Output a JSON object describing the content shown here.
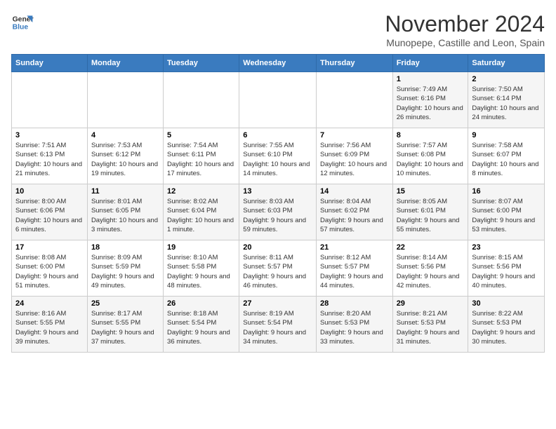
{
  "header": {
    "logo_line1": "General",
    "logo_line2": "Blue",
    "title": "November 2024",
    "subtitle": "Munopepe, Castille and Leon, Spain"
  },
  "weekdays": [
    "Sunday",
    "Monday",
    "Tuesday",
    "Wednesday",
    "Thursday",
    "Friday",
    "Saturday"
  ],
  "weeks": [
    [
      {
        "day": "",
        "info": ""
      },
      {
        "day": "",
        "info": ""
      },
      {
        "day": "",
        "info": ""
      },
      {
        "day": "",
        "info": ""
      },
      {
        "day": "",
        "info": ""
      },
      {
        "day": "1",
        "info": "Sunrise: 7:49 AM\nSunset: 6:16 PM\nDaylight: 10 hours and 26 minutes."
      },
      {
        "day": "2",
        "info": "Sunrise: 7:50 AM\nSunset: 6:14 PM\nDaylight: 10 hours and 24 minutes."
      }
    ],
    [
      {
        "day": "3",
        "info": "Sunrise: 7:51 AM\nSunset: 6:13 PM\nDaylight: 10 hours and 21 minutes."
      },
      {
        "day": "4",
        "info": "Sunrise: 7:53 AM\nSunset: 6:12 PM\nDaylight: 10 hours and 19 minutes."
      },
      {
        "day": "5",
        "info": "Sunrise: 7:54 AM\nSunset: 6:11 PM\nDaylight: 10 hours and 17 minutes."
      },
      {
        "day": "6",
        "info": "Sunrise: 7:55 AM\nSunset: 6:10 PM\nDaylight: 10 hours and 14 minutes."
      },
      {
        "day": "7",
        "info": "Sunrise: 7:56 AM\nSunset: 6:09 PM\nDaylight: 10 hours and 12 minutes."
      },
      {
        "day": "8",
        "info": "Sunrise: 7:57 AM\nSunset: 6:08 PM\nDaylight: 10 hours and 10 minutes."
      },
      {
        "day": "9",
        "info": "Sunrise: 7:58 AM\nSunset: 6:07 PM\nDaylight: 10 hours and 8 minutes."
      }
    ],
    [
      {
        "day": "10",
        "info": "Sunrise: 8:00 AM\nSunset: 6:06 PM\nDaylight: 10 hours and 6 minutes."
      },
      {
        "day": "11",
        "info": "Sunrise: 8:01 AM\nSunset: 6:05 PM\nDaylight: 10 hours and 3 minutes."
      },
      {
        "day": "12",
        "info": "Sunrise: 8:02 AM\nSunset: 6:04 PM\nDaylight: 10 hours and 1 minute."
      },
      {
        "day": "13",
        "info": "Sunrise: 8:03 AM\nSunset: 6:03 PM\nDaylight: 9 hours and 59 minutes."
      },
      {
        "day": "14",
        "info": "Sunrise: 8:04 AM\nSunset: 6:02 PM\nDaylight: 9 hours and 57 minutes."
      },
      {
        "day": "15",
        "info": "Sunrise: 8:05 AM\nSunset: 6:01 PM\nDaylight: 9 hours and 55 minutes."
      },
      {
        "day": "16",
        "info": "Sunrise: 8:07 AM\nSunset: 6:00 PM\nDaylight: 9 hours and 53 minutes."
      }
    ],
    [
      {
        "day": "17",
        "info": "Sunrise: 8:08 AM\nSunset: 6:00 PM\nDaylight: 9 hours and 51 minutes."
      },
      {
        "day": "18",
        "info": "Sunrise: 8:09 AM\nSunset: 5:59 PM\nDaylight: 9 hours and 49 minutes."
      },
      {
        "day": "19",
        "info": "Sunrise: 8:10 AM\nSunset: 5:58 PM\nDaylight: 9 hours and 48 minutes."
      },
      {
        "day": "20",
        "info": "Sunrise: 8:11 AM\nSunset: 5:57 PM\nDaylight: 9 hours and 46 minutes."
      },
      {
        "day": "21",
        "info": "Sunrise: 8:12 AM\nSunset: 5:57 PM\nDaylight: 9 hours and 44 minutes."
      },
      {
        "day": "22",
        "info": "Sunrise: 8:14 AM\nSunset: 5:56 PM\nDaylight: 9 hours and 42 minutes."
      },
      {
        "day": "23",
        "info": "Sunrise: 8:15 AM\nSunset: 5:56 PM\nDaylight: 9 hours and 40 minutes."
      }
    ],
    [
      {
        "day": "24",
        "info": "Sunrise: 8:16 AM\nSunset: 5:55 PM\nDaylight: 9 hours and 39 minutes."
      },
      {
        "day": "25",
        "info": "Sunrise: 8:17 AM\nSunset: 5:55 PM\nDaylight: 9 hours and 37 minutes."
      },
      {
        "day": "26",
        "info": "Sunrise: 8:18 AM\nSunset: 5:54 PM\nDaylight: 9 hours and 36 minutes."
      },
      {
        "day": "27",
        "info": "Sunrise: 8:19 AM\nSunset: 5:54 PM\nDaylight: 9 hours and 34 minutes."
      },
      {
        "day": "28",
        "info": "Sunrise: 8:20 AM\nSunset: 5:53 PM\nDaylight: 9 hours and 33 minutes."
      },
      {
        "day": "29",
        "info": "Sunrise: 8:21 AM\nSunset: 5:53 PM\nDaylight: 9 hours and 31 minutes."
      },
      {
        "day": "30",
        "info": "Sunrise: 8:22 AM\nSunset: 5:53 PM\nDaylight: 9 hours and 30 minutes."
      }
    ]
  ]
}
